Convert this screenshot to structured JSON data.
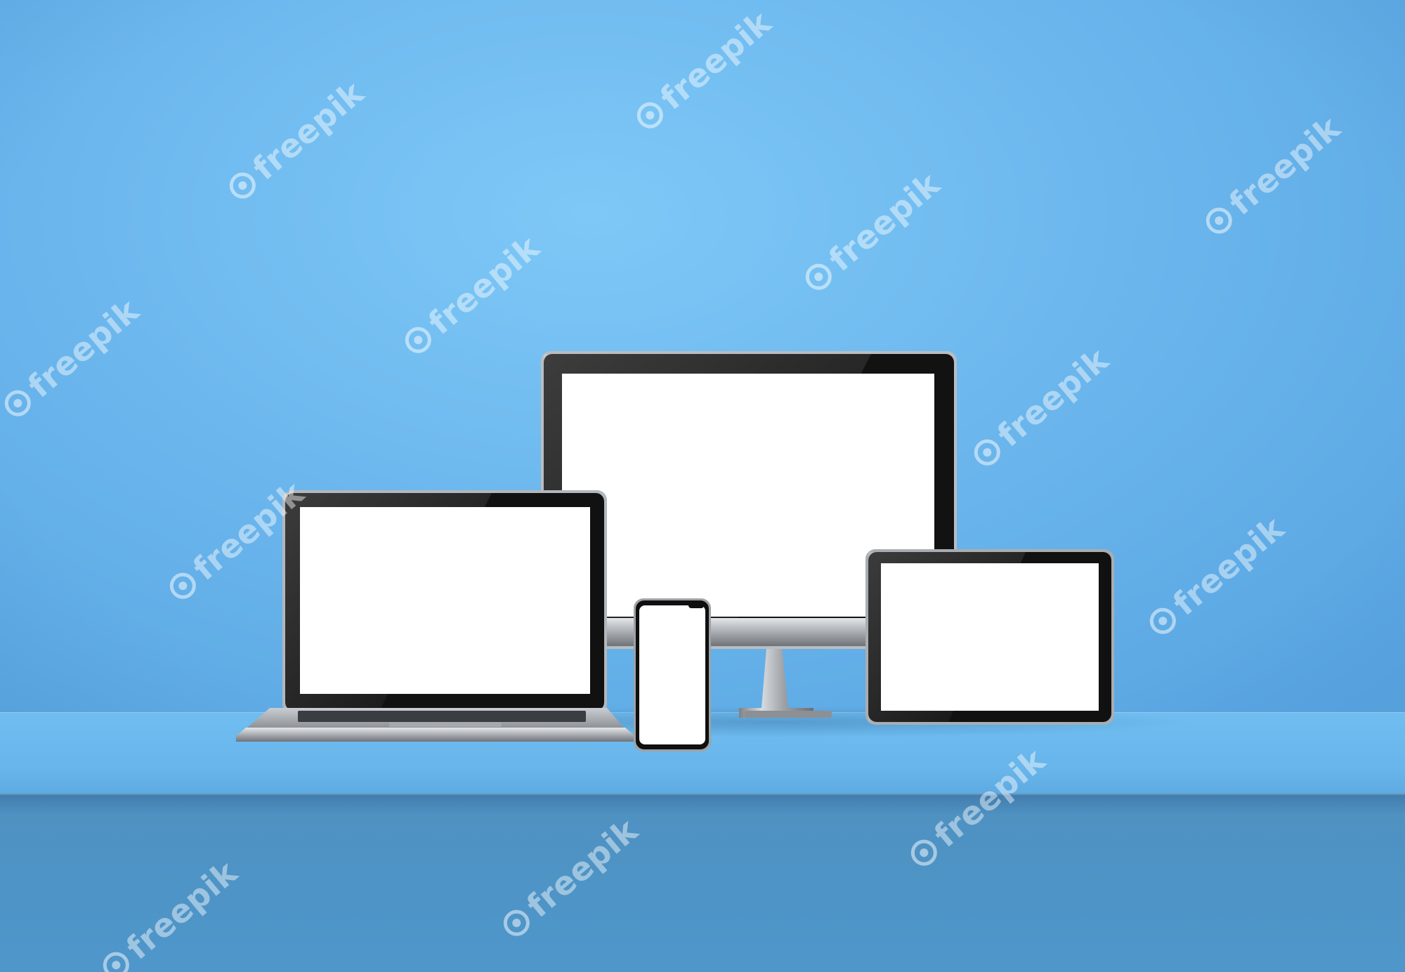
{
  "scene": {
    "watermark_text": "freepik",
    "colors": {
      "wall": "#74bff3",
      "shelf_top": "#67b5ea",
      "shelf_front": "#4f93c6",
      "screen": "#ffffff",
      "bezel": "#111111",
      "frame_silver": "#b8bcc0"
    },
    "devices": [
      {
        "type": "desktop-monitor"
      },
      {
        "type": "laptop"
      },
      {
        "type": "smartphone"
      },
      {
        "type": "tablet"
      }
    ]
  }
}
